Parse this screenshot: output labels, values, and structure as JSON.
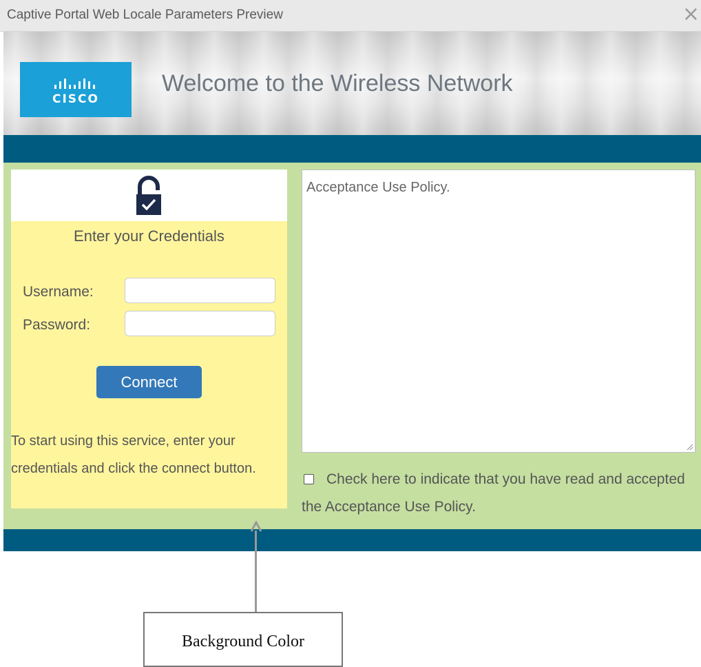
{
  "window": {
    "title": "Captive Portal Web Locale Parameters Preview",
    "close_glyph": "×"
  },
  "header": {
    "logo_text": "CISCO",
    "welcome_text": "Welcome to the Wireless Network"
  },
  "colors": {
    "band": "#005b80",
    "content_background": "#c5dfa1",
    "login_background": "#fff59d",
    "button": "#3378b8",
    "logo": "#1ba0d7"
  },
  "login": {
    "icon": "padlock-check-icon",
    "heading": "Enter your Credentials",
    "username_label": "Username:",
    "password_label": "Password:",
    "username_value": "",
    "password_value": "",
    "connect_label": "Connect",
    "instructions": "To start using this service, enter your credentials and click the connect button."
  },
  "policy": {
    "text": "Acceptance Use Policy.",
    "checkbox_checked": false,
    "checkbox_label": "Check here to indicate that you have read and accepted the Acceptance Use Policy."
  },
  "annotation": {
    "label": "Background Color"
  }
}
